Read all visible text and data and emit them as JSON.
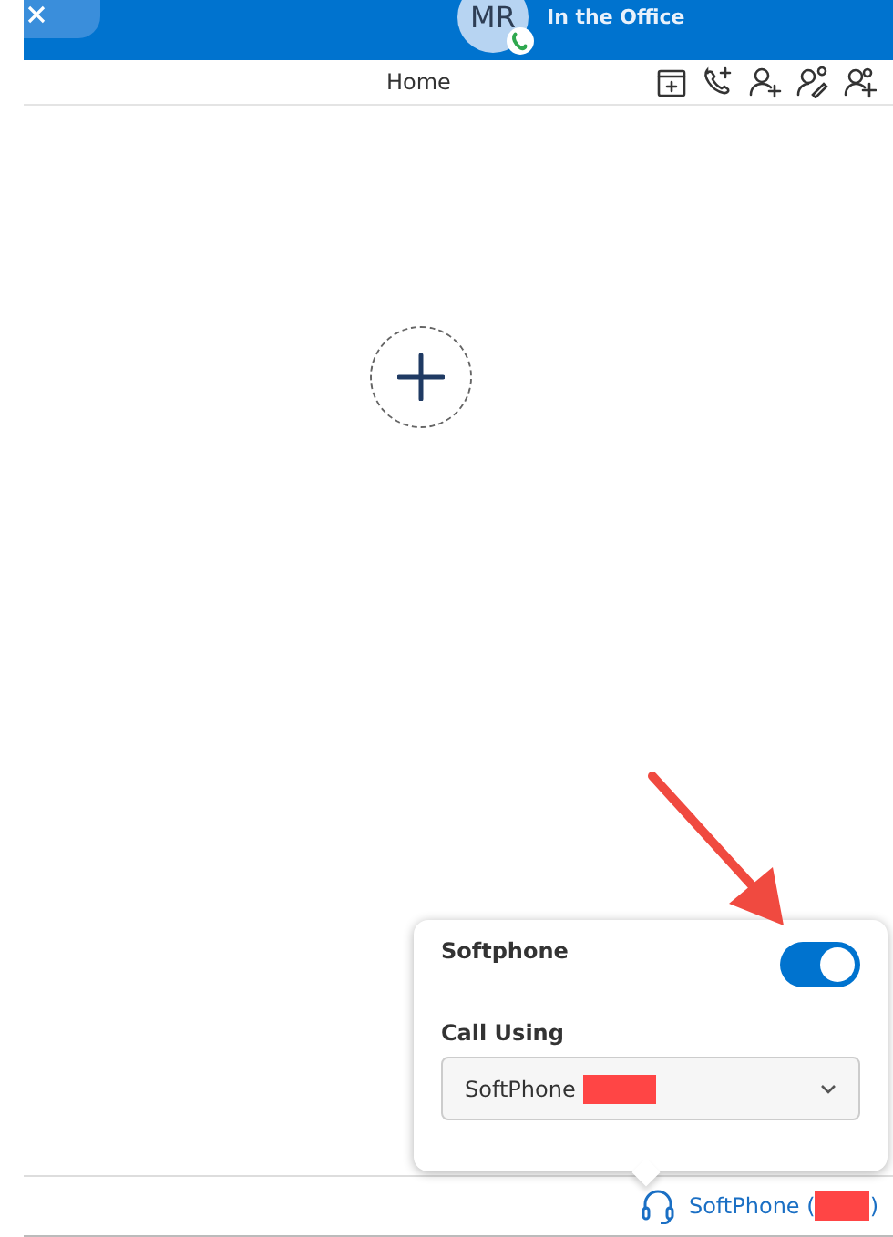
{
  "header": {
    "avatar_initials": "MR",
    "presence_on_call": true,
    "status": "In the Office"
  },
  "title": "Home",
  "popover": {
    "softphone_label": "Softphone",
    "softphone_on": true,
    "call_using_label": "Call Using",
    "select_value": "SoftPhone"
  },
  "status_bar": {
    "device_prefix": "SoftPhone (",
    "device_suffix": ")"
  }
}
